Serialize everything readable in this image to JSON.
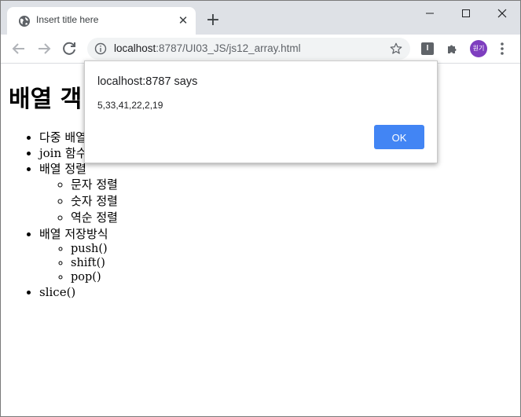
{
  "browser": {
    "tab": {
      "title": "Insert title here",
      "close_glyph": "✕"
    },
    "new_tab_glyph": "+",
    "window_controls": {
      "minimize": "—",
      "maximize": "☐",
      "close": "✕"
    },
    "address_bar": {
      "host": "localhost",
      "rest": ":8787/UI03_JS/js12_array.html"
    },
    "extension_label": "I",
    "avatar_label": "원기",
    "icons": [
      "back-arrow-icon",
      "forward-arrow-icon",
      "reload-icon",
      "info-icon",
      "star-icon",
      "puzzle-icon",
      "kebab-menu-icon",
      "globe-icon"
    ]
  },
  "page": {
    "heading": "배열 객",
    "list": [
      {
        "label": "다중 배열"
      },
      {
        "label": "join 함수"
      },
      {
        "label": "배열 정렬",
        "children": [
          "문자 정렬",
          "숫자 정렬",
          "역순 정렬"
        ]
      },
      {
        "label": "배열 저장방식",
        "children": [
          "push()",
          "shift()",
          "pop()"
        ]
      },
      {
        "label": "slice()"
      }
    ]
  },
  "dialog": {
    "title": "localhost:8787 says",
    "message": "5,33,41,22,2,19",
    "ok_label": "OK",
    "ok_color": "#4285f4"
  }
}
